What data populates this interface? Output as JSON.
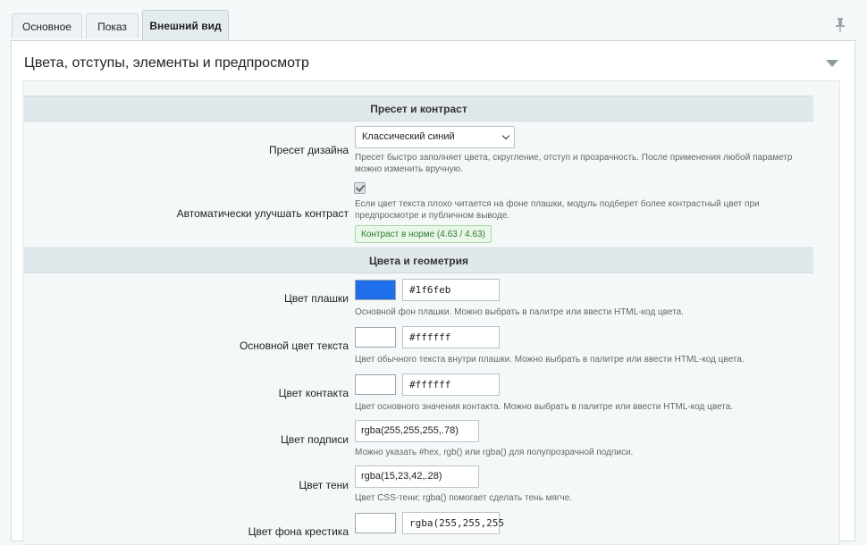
{
  "tabs": [
    {
      "label": "Основное"
    },
    {
      "label": "Показ"
    },
    {
      "label": "Внешний вид"
    }
  ],
  "panel": {
    "title": "Цвета, отступы, элементы и предпросмотр"
  },
  "sections": [
    {
      "title": "Пресет и контраст"
    },
    {
      "title": "Цвета и геометрия"
    }
  ],
  "preset": {
    "label": "Пресет дизайна",
    "value": "Классический синий",
    "hint": "Пресет быстро заполняет цвета, скругление, отступ и прозрачность. После применения любой параметр можно изменить вручную."
  },
  "contrast": {
    "label": "Автоматически улучшать контраст",
    "checked": true,
    "hint": "Если цвет текста плохо читается на фоне плашки, модуль подберет более контрастный цвет при предпросмотре и публичном выводе.",
    "status": "Контраст в норме (4.63 / 4.63)"
  },
  "fields": {
    "plate_color": {
      "label": "Цвет плашки",
      "value": "#1f6feb",
      "color": "#1f6feb",
      "hint": "Основной фон плашки. Можно выбрать в палитре или ввести HTML-код цвета."
    },
    "text_color": {
      "label": "Основной цвет текста",
      "value": "#ffffff",
      "color": "#ffffff",
      "hint": "Цвет обычного текста внутри плашки. Можно выбрать в палитре или ввести HTML-код цвета."
    },
    "contact_color": {
      "label": "Цвет контакта",
      "value": "#ffffff",
      "color": "#ffffff",
      "hint": "Цвет основного значения контакта. Можно выбрать в палитре или ввести HTML-код цвета."
    },
    "caption_color": {
      "label": "Цвет подписи",
      "value": "rgba(255,255,255,.78)",
      "hint": "Можно указать #hex, rgb() или rgba() для полупрозрачной подписи."
    },
    "shadow_color": {
      "label": "Цвет тени",
      "value": "rgba(15,23,42,.28)",
      "hint": "Цвет CSS-тени; rgba() помогает сделать тень мягче."
    },
    "close_bg_color": {
      "label": "Цвет фона крестика",
      "value": "rgba(255,255,255",
      "color": "#ffffff"
    }
  }
}
